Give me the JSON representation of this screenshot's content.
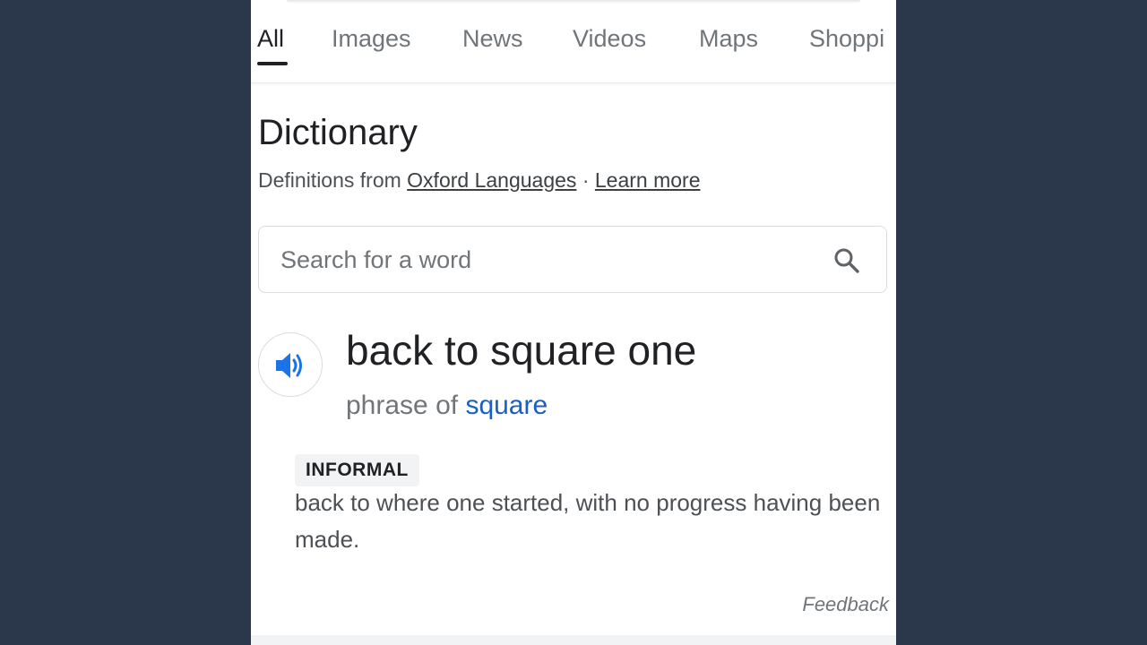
{
  "tabs": [
    {
      "label": "All",
      "active": true
    },
    {
      "label": "Images"
    },
    {
      "label": "News"
    },
    {
      "label": "Videos"
    },
    {
      "label": "Maps"
    },
    {
      "label": "Shoppi"
    }
  ],
  "dictionary": {
    "title": "Dictionary",
    "source_prefix": "Definitions from",
    "source_link": "Oxford Languages",
    "separator": "·",
    "learn_more": "Learn more",
    "search_placeholder": "Search for a word",
    "headword": "back to square one",
    "phrase_prefix": "phrase of",
    "phrase_link": "square",
    "register_label": "INFORMAL",
    "definition": "back to where one started, with no progress having been made.",
    "feedback": "Feedback"
  },
  "colors": {
    "background": "#2b384b",
    "link_blue": "#1a5fc4",
    "speaker_blue": "#1a73e8"
  },
  "icons": {
    "search": "search-icon",
    "speaker": "speaker-icon"
  }
}
